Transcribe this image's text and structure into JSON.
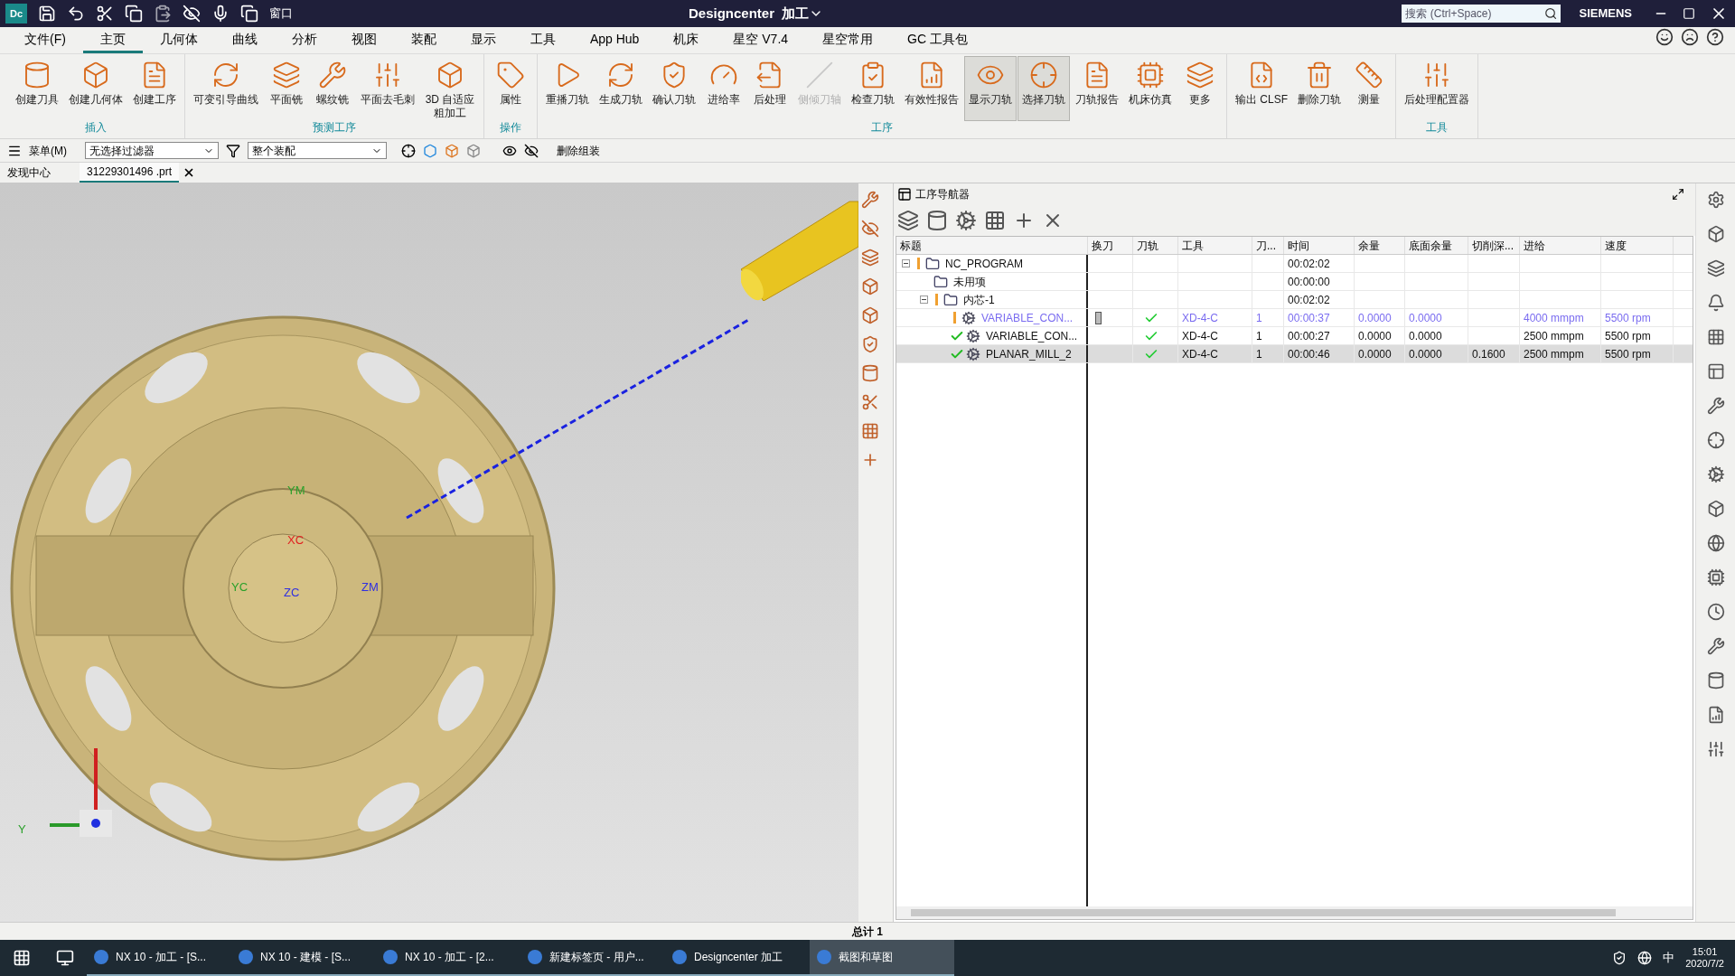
{
  "title_bar": {
    "app_badge": "Dc",
    "title": "Designcenter  加工",
    "window_menu": "窗口",
    "search": {
      "placeholder": "搜索 (Ctrl+Space)"
    },
    "brand": "SIEMENS"
  },
  "menu_tabs": [
    {
      "label": "文件(F)",
      "selected": false
    },
    {
      "label": "主页",
      "selected": true
    },
    {
      "label": "几何体",
      "selected": false
    },
    {
      "label": "曲线",
      "selected": false
    },
    {
      "label": "分析",
      "selected": false
    },
    {
      "label": "视图",
      "selected": false
    },
    {
      "label": "装配",
      "selected": false
    },
    {
      "label": "显示",
      "selected": false
    },
    {
      "label": "工具",
      "selected": false
    },
    {
      "label": "App Hub",
      "selected": false
    },
    {
      "label": "机床",
      "selected": false
    },
    {
      "label": "星空 V7.4",
      "selected": false
    },
    {
      "label": "星空常用",
      "selected": false
    },
    {
      "label": "GC 工具包",
      "selected": false
    }
  ],
  "ribbon_groups": [
    {
      "title": "插入",
      "buttons": [
        {
          "label": "创建刀具",
          "disabled": false,
          "selected": false
        },
        {
          "label": "创建几何体",
          "disabled": false,
          "selected": false
        },
        {
          "label": "创建工序",
          "disabled": false,
          "selected": false
        }
      ]
    },
    {
      "title": "预测工序",
      "buttons": [
        {
          "label": "可变引导曲线",
          "disabled": false,
          "selected": false
        },
        {
          "label": "平面铣",
          "disabled": false,
          "selected": false
        },
        {
          "label": "螺纹铣",
          "disabled": false,
          "selected": false
        },
        {
          "label": "平面去毛刺",
          "disabled": false,
          "selected": false
        },
        {
          "label": "3D 自适应粗加工",
          "disabled": false,
          "selected": false
        }
      ]
    },
    {
      "title": "操作",
      "buttons": [
        {
          "label": "属性",
          "disabled": false,
          "selected": false
        }
      ]
    },
    {
      "title": "工序",
      "buttons": [
        {
          "label": "重播刀轨",
          "disabled": false,
          "selected": false
        },
        {
          "label": "生成刀轨",
          "disabled": false,
          "selected": false
        },
        {
          "label": "确认刀轨",
          "disabled": false,
          "selected": false
        },
        {
          "label": "进给率",
          "disabled": false,
          "selected": false
        },
        {
          "label": "后处理",
          "disabled": false,
          "selected": false
        },
        {
          "label": "侧倾刀轴",
          "disabled": true,
          "selected": false
        },
        {
          "label": "检查刀轨",
          "disabled": false,
          "selected": false
        },
        {
          "label": "有效性报告",
          "disabled": false,
          "selected": false
        },
        {
          "label": "显示刀轨",
          "disabled": false,
          "selected": true
        },
        {
          "label": "选择刀轨",
          "disabled": false,
          "selected": true
        },
        {
          "label": "刀轨报告",
          "disabled": false,
          "selected": false
        },
        {
          "label": "机床仿真",
          "disabled": false,
          "selected": false
        },
        {
          "label": "更多",
          "disabled": false,
          "selected": false
        }
      ]
    },
    {
      "buttons": [
        {
          "label": "输出 CLSF",
          "disabled": false,
          "selected": false
        },
        {
          "label": "删除刀轨",
          "disabled": false,
          "selected": false
        },
        {
          "label": "测量",
          "disabled": false,
          "selected": false
        }
      ]
    },
    {
      "title": "工具",
      "buttons": [
        {
          "label": "后处理配置器",
          "disabled": false,
          "selected": false
        }
      ]
    }
  ],
  "quick_toolbar": {
    "menu": "菜单(M)",
    "filter": "无选择过滤器",
    "scope": "整个装配",
    "action": "删除组装"
  },
  "doc_tabs": [
    {
      "label": "发现中心",
      "selected": false
    },
    {
      "label": "31229301496 .prt",
      "selected": true
    }
  ],
  "viewport": {
    "labels": [
      "YM",
      "XC",
      "YC",
      "ZC",
      "ZM",
      "Y"
    ]
  },
  "navigator": {
    "title": "工序导航器",
    "columns": [
      "标题",
      "换刀",
      "刀轨",
      "工具",
      "刀...",
      "时间",
      "余量",
      "底面余量",
      "切削深...",
      "进给",
      "速度"
    ],
    "rows": [
      {
        "warning": true,
        "complete": false,
        "expanded": true,
        "modified": false,
        "selected": false,
        "cells": [
          "NC_PROGRAM",
          "",
          "",
          "",
          "",
          "00:02:02",
          "",
          "",
          "",
          "",
          ""
        ],
        "children": [
          {
            "warning": false,
            "complete": false,
            "modified": false,
            "selected": false,
            "cells": [
              "未用项",
              "",
              "",
              "",
              "",
              "00:00:00",
              "",
              "",
              "",
              "",
              ""
            ]
          },
          {
            "warning": true,
            "complete": false,
            "expanded": true,
            "modified": false,
            "selected": false,
            "cells": [
              "内芯-1",
              "",
              "",
              "",
              "",
              "00:02:02",
              "",
              "",
              "",
              "",
              ""
            ],
            "children": [
              {
                "warning": true,
                "complete": false,
                "modified": true,
                "selected": false,
                "tool_change": true,
                "toolpath_ok": true,
                "cells": [
                  "VARIABLE_CON...",
                  "",
                  "",
                  "XD-4-C",
                  "1",
                  "00:00:37",
                  "0.0000",
                  "0.0000",
                  "",
                  "4000 mmpm",
                  "5500 rpm"
                ]
              },
              {
                "warning": false,
                "complete": true,
                "modified": false,
                "selected": false,
                "tool_change": false,
                "toolpath_ok": true,
                "cells": [
                  "VARIABLE_CON...",
                  "",
                  "",
                  "XD-4-C",
                  "1",
                  "00:00:27",
                  "0.0000",
                  "0.0000",
                  "",
                  "2500 mmpm",
                  "5500 rpm"
                ]
              },
              {
                "warning": false,
                "complete": true,
                "modified": false,
                "selected": true,
                "tool_change": false,
                "toolpath_ok": true,
                "cells": [
                  "PLANAR_MILL_2",
                  "",
                  "",
                  "XD-4-C",
                  "1",
                  "00:00:46",
                  "0.0000",
                  "0.0000",
                  "0.1600",
                  "2500 mmpm",
                  "5500 rpm"
                ]
              }
            ]
          }
        ]
      }
    ]
  },
  "status_bar": {
    "text": "总计 1"
  },
  "taskbar": {
    "items": [
      {
        "label": "NX 10 - 加工 - [S...",
        "selected": false
      },
      {
        "label": "NX 10 - 建模 - [S...",
        "selected": false
      },
      {
        "label": "NX 10 - 加工 - [2...",
        "selected": false
      },
      {
        "label": "新建标签页 - 用户...",
        "selected": false
      },
      {
        "label": "Designcenter 加工",
        "selected": false
      },
      {
        "label": "截图和草图",
        "selected": true
      }
    ],
    "ime": "中",
    "time": "15:01",
    "date": "2020/7/2"
  }
}
